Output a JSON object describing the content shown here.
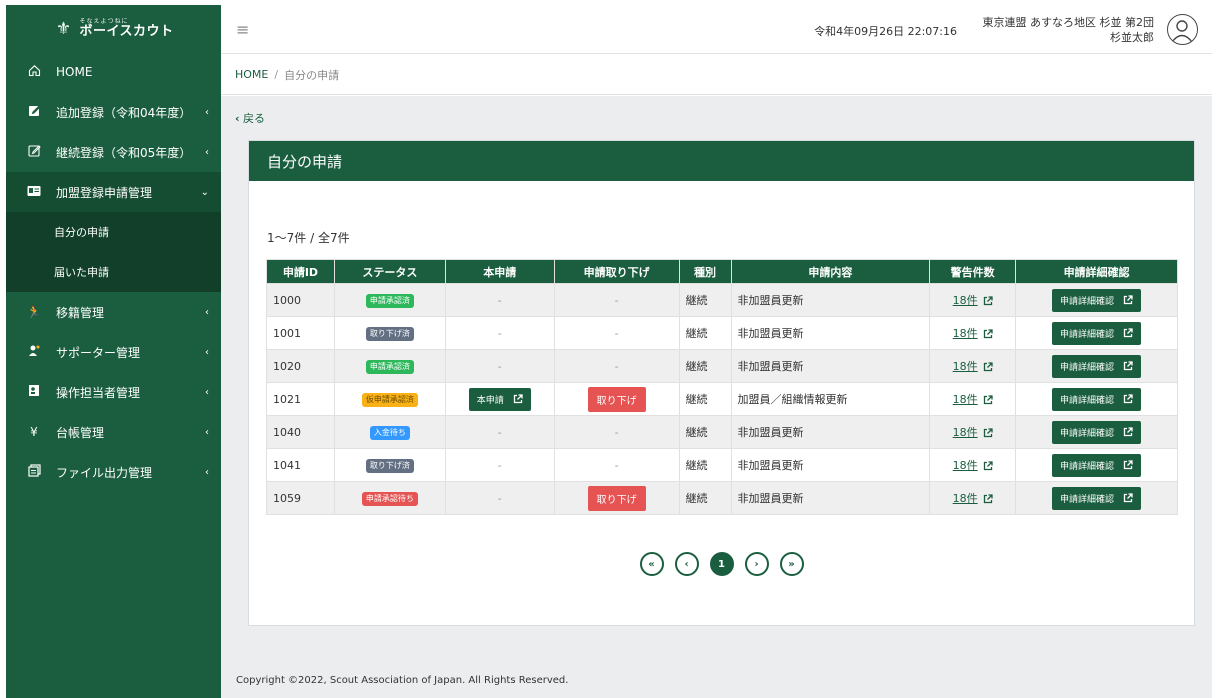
{
  "logo": {
    "sub": "そなえよつねに",
    "main": "ボーイスカウト"
  },
  "sidebar": {
    "items": [
      {
        "label": "HOME",
        "icon": "home-icon",
        "chevron": ""
      },
      {
        "label": "追加登録（令和04年度）",
        "icon": "edit-icon",
        "chevron": "‹"
      },
      {
        "label": "継続登録（令和05年度）",
        "icon": "edit-outline-icon",
        "chevron": "‹"
      },
      {
        "label": "加盟登録申請管理",
        "icon": "id-card-icon",
        "chevron": "⌄"
      },
      {
        "label": "移籍管理",
        "icon": "transfer-icon",
        "chevron": "‹"
      },
      {
        "label": "サポーター管理",
        "icon": "supporter-icon",
        "chevron": "‹"
      },
      {
        "label": "操作担当者管理",
        "icon": "operator-icon",
        "chevron": "‹"
      },
      {
        "label": "台帳管理",
        "icon": "yen-icon",
        "chevron": "‹"
      },
      {
        "label": "ファイル出力管理",
        "icon": "file-output-icon",
        "chevron": "‹"
      }
    ],
    "subitems": [
      {
        "label": "自分の申請"
      },
      {
        "label": "届いた申請"
      }
    ]
  },
  "topbar": {
    "menu_icon": "≡",
    "datetime": "令和4年09月26日 22:07:16",
    "org": "東京連盟 あすなろ地区 杉並 第2団",
    "user": "杉並太郎"
  },
  "breadcrumb": {
    "home": "HOME",
    "separator": "/",
    "current": "自分の申請"
  },
  "back_label": "戻る",
  "card": {
    "title": "自分の申請",
    "count": "1〜7件 / 全7件",
    "columns": [
      "申請ID",
      "ステータス",
      "本申請",
      "申請取り下げ",
      "種別",
      "申請内容",
      "警告件数",
      "申請詳細確認"
    ],
    "rows": [
      {
        "id": "1000",
        "status": "申請承認済",
        "status_color": "green",
        "main": "-",
        "withdraw": "-",
        "type": "継続",
        "content": "非加盟員更新",
        "warnings": "18件",
        "detail": "申請詳細確認"
      },
      {
        "id": "1001",
        "status": "取り下げ済",
        "status_color": "gray",
        "main": "-",
        "withdraw": "-",
        "type": "継続",
        "content": "非加盟員更新",
        "warnings": "18件",
        "detail": "申請詳細確認"
      },
      {
        "id": "1020",
        "status": "申請承認済",
        "status_color": "green",
        "main": "-",
        "withdraw": "-",
        "type": "継続",
        "content": "非加盟員更新",
        "warnings": "18件",
        "detail": "申請詳細確認"
      },
      {
        "id": "1021",
        "status": "仮申請承認済",
        "status_color": "yellow",
        "main": "本申請",
        "withdraw": "取り下げ",
        "type": "継続",
        "content": "加盟員／組織情報更新",
        "warnings": "18件",
        "detail": "申請詳細確認"
      },
      {
        "id": "1040",
        "status": "入金待ち",
        "status_color": "blue",
        "main": "-",
        "withdraw": "-",
        "type": "継続",
        "content": "非加盟員更新",
        "warnings": "18件",
        "detail": "申請詳細確認"
      },
      {
        "id": "1041",
        "status": "取り下げ済",
        "status_color": "gray",
        "main": "-",
        "withdraw": "-",
        "type": "継続",
        "content": "非加盟員更新",
        "warnings": "18件",
        "detail": "申請詳細確認"
      },
      {
        "id": "1059",
        "status": "申請承認待ち",
        "status_color": "red",
        "main": "-",
        "withdraw": "取り下げ",
        "type": "継続",
        "content": "非加盟員更新",
        "warnings": "18件",
        "detail": "申請詳細確認"
      }
    ]
  },
  "pagination": {
    "first": "«",
    "prev": "‹",
    "current": "1",
    "next": "›",
    "last": "»"
  },
  "footer": "Copyright ©2022, Scout Association of Japan. All Rights Reserved.",
  "colors": {
    "primary": "#1b5e3f",
    "green": "#2eb85c",
    "gray": "#636f83",
    "yellow": "#f9b115",
    "blue": "#3399ff",
    "red": "#e55353"
  }
}
